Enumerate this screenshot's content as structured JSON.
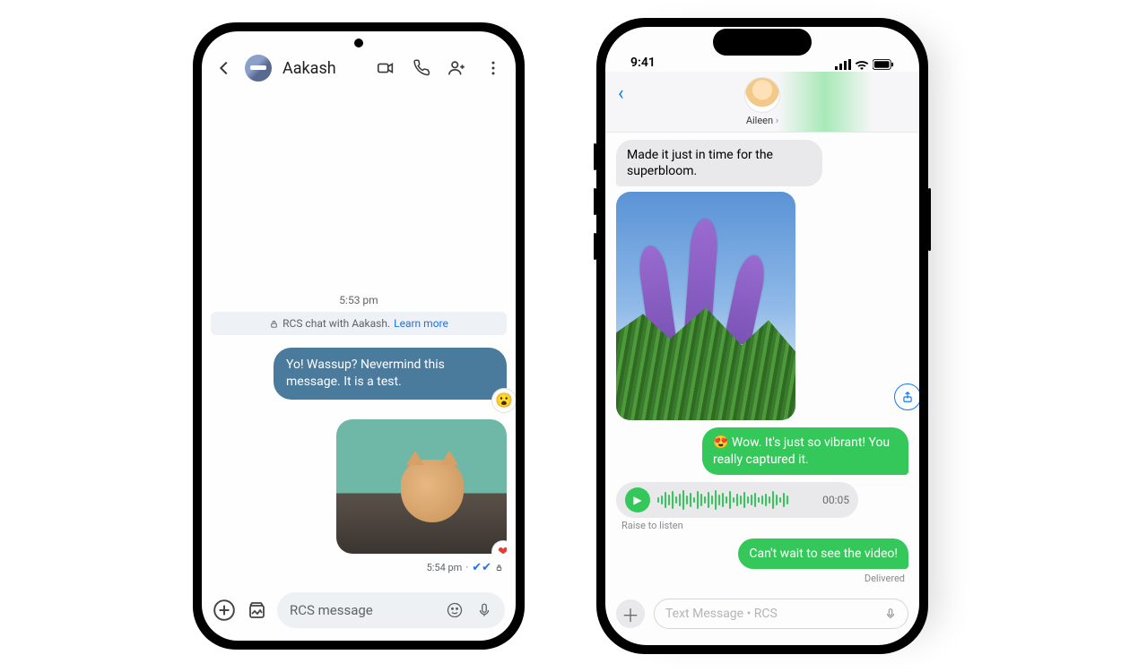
{
  "android": {
    "contact_name": "Aakash",
    "timestamp_label": "5:53 pm",
    "rcs_banner_prefix": "RCS chat with Aakash.",
    "rcs_banner_link": "Learn more",
    "sent_bubble_text": "Yo! Wassup? Nevermind this message. It is a test.",
    "sent_reaction": "😮",
    "image_reaction": "❤",
    "sent_time": "5:54 pm",
    "compose_placeholder": "RCS message"
  },
  "ios": {
    "status_time": "9:41",
    "contact_name": "Aileen",
    "recv_bubble_text": "Made it just in time for the superbloom.",
    "sent_bubble1": "😍 Wow. It's just so vibrant! You really captured it.",
    "voice_duration": "00:05",
    "raise_hint": "Raise to listen",
    "sent_bubble2": "Can't wait to see the video!",
    "delivered_label": "Delivered",
    "compose_placeholder": "Text Message • RCS"
  }
}
